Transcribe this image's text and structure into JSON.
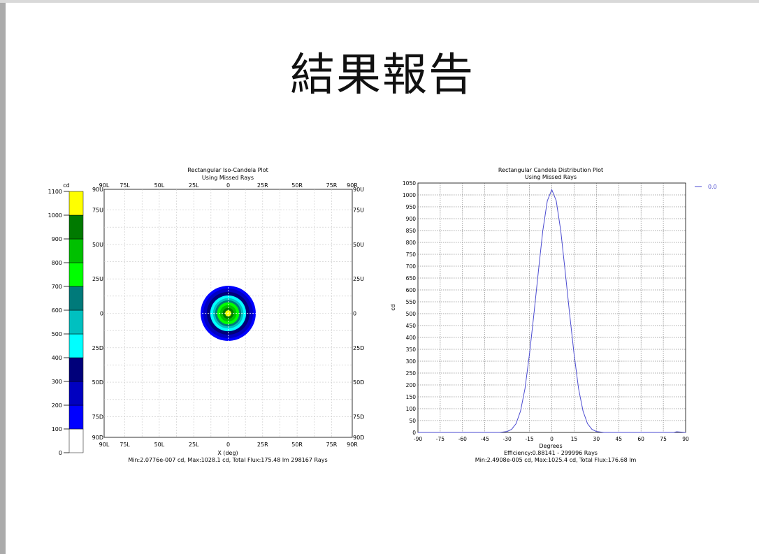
{
  "page": {
    "title": "結果報告"
  },
  "colors": {
    "grid": "#c8c8c8",
    "line": "#4a4ad0",
    "legend_line": "#4a4ad0",
    "axis": "#000000"
  },
  "chart_data": [
    {
      "type": "heatmap",
      "title": "Rectangular Iso-Candela Plot",
      "subtitle": "Using Missed Rays",
      "xlabel": "X (deg)",
      "footer": "Min:2.0776e-007 cd, Max:1028.1 cd, Total Flux:175.48 lm 298167 Rays",
      "x_ticks": [
        "90L",
        "75L",
        "50L",
        "25L",
        "0",
        "25R",
        "50R",
        "75R",
        "90R"
      ],
      "x_tick_values": [
        -90,
        -75,
        -50,
        -25,
        0,
        25,
        50,
        75,
        90
      ],
      "y_ticks": [
        "90U",
        "75U",
        "50U",
        "25U",
        "0",
        "25D",
        "50D",
        "75D",
        "90D"
      ],
      "y_tick_values": [
        90,
        75,
        50,
        25,
        0,
        -25,
        -50,
        -75,
        -90
      ],
      "xlim": [
        -90,
        90
      ],
      "ylim": [
        -90,
        90
      ],
      "grid": true,
      "colorbar": {
        "label": "cd",
        "ticks": [
          0,
          100,
          200,
          300,
          400,
          500,
          600,
          700,
          800,
          900,
          1000,
          1100
        ],
        "bands": [
          {
            "from": 0,
            "to": 100,
            "color": "#ffffff"
          },
          {
            "from": 100,
            "to": 200,
            "color": "#0000ff"
          },
          {
            "from": 200,
            "to": 300,
            "color": "#0000c0"
          },
          {
            "from": 300,
            "to": 400,
            "color": "#00007a"
          },
          {
            "from": 400,
            "to": 500,
            "color": "#00ffff"
          },
          {
            "from": 500,
            "to": 600,
            "color": "#00c0c0"
          },
          {
            "from": 600,
            "to": 700,
            "color": "#007a7a"
          },
          {
            "from": 700,
            "to": 800,
            "color": "#00ff00"
          },
          {
            "from": 800,
            "to": 900,
            "color": "#00c000"
          },
          {
            "from": 900,
            "to": 1000,
            "color": "#007a00"
          },
          {
            "from": 1000,
            "to": 1100,
            "color": "#ffff00"
          }
        ]
      },
      "contours": [
        {
          "level": 100,
          "radius": 20,
          "color": "#0000ff"
        },
        {
          "level": 200,
          "radius": 18,
          "color": "#0000c0"
        },
        {
          "level": 300,
          "radius": 15.5,
          "color": "#00007a"
        },
        {
          "level": 400,
          "radius": 13,
          "color": "#00ffff"
        },
        {
          "level": 500,
          "radius": 11,
          "color": "#00c0c0"
        },
        {
          "level": 600,
          "radius": 9.5,
          "color": "#007a7a"
        },
        {
          "level": 700,
          "radius": 8,
          "color": "#00ff00"
        },
        {
          "level": 800,
          "radius": 6,
          "color": "#00c000"
        },
        {
          "level": 900,
          "radius": 4,
          "color": "#007a00"
        },
        {
          "level": 1000,
          "radius": 2.2,
          "color": "#ffff00"
        }
      ]
    },
    {
      "type": "line",
      "title": "Rectangular Candela Distribution Plot",
      "subtitle": "Using Missed Rays",
      "xlabel": "Degrees",
      "ylabel": "cd",
      "footer_line1": "Efficiency:0.88141 - 299996 Rays",
      "footer_line2": "Min:2.4908e-005 cd, Max:1025.4 cd, Total Flux:176.68 lm",
      "xlim": [
        -90,
        90
      ],
      "ylim": [
        0,
        1050
      ],
      "x_ticks": [
        -90,
        -75,
        -60,
        -45,
        -30,
        -15,
        0,
        15,
        30,
        45,
        60,
        75,
        90
      ],
      "y_ticks": [
        0,
        50,
        100,
        150,
        200,
        250,
        300,
        350,
        400,
        450,
        500,
        550,
        600,
        650,
        700,
        750,
        800,
        850,
        900,
        950,
        1000,
        1050
      ],
      "grid": true,
      "legend_position": "top-right",
      "series": [
        {
          "name": "0.0",
          "x": [
            -90,
            -75,
            -60,
            -45,
            -35,
            -30,
            -27,
            -24,
            -21,
            -18,
            -15,
            -12,
            -9,
            -6,
            -3,
            0,
            3,
            6,
            9,
            12,
            15,
            18,
            21,
            24,
            27,
            30,
            35,
            45,
            60,
            75,
            82,
            84,
            90
          ],
          "y": [
            0,
            0,
            0,
            0,
            0,
            4,
            13,
            37,
            90,
            185,
            330,
            500,
            680,
            850,
            975,
            1022,
            975,
            850,
            680,
            500,
            330,
            185,
            90,
            37,
            13,
            4,
            0,
            0,
            0,
            0,
            0,
            3,
            0
          ]
        }
      ]
    }
  ]
}
